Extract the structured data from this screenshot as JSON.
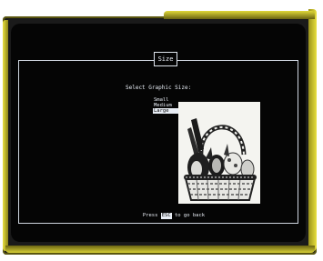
{
  "window": {
    "title": "Size"
  },
  "dialog": {
    "prompt": "Select Graphic Size:",
    "options": [
      {
        "label": "Small",
        "selected": false
      },
      {
        "label": "Medium",
        "selected": false
      },
      {
        "label": "Large",
        "selected": true
      }
    ]
  },
  "preview": {
    "icon": "basket-with-bunny-graphic"
  },
  "footer": {
    "prefix": "Press",
    "key": "ESC",
    "suffix": "to go back"
  }
}
